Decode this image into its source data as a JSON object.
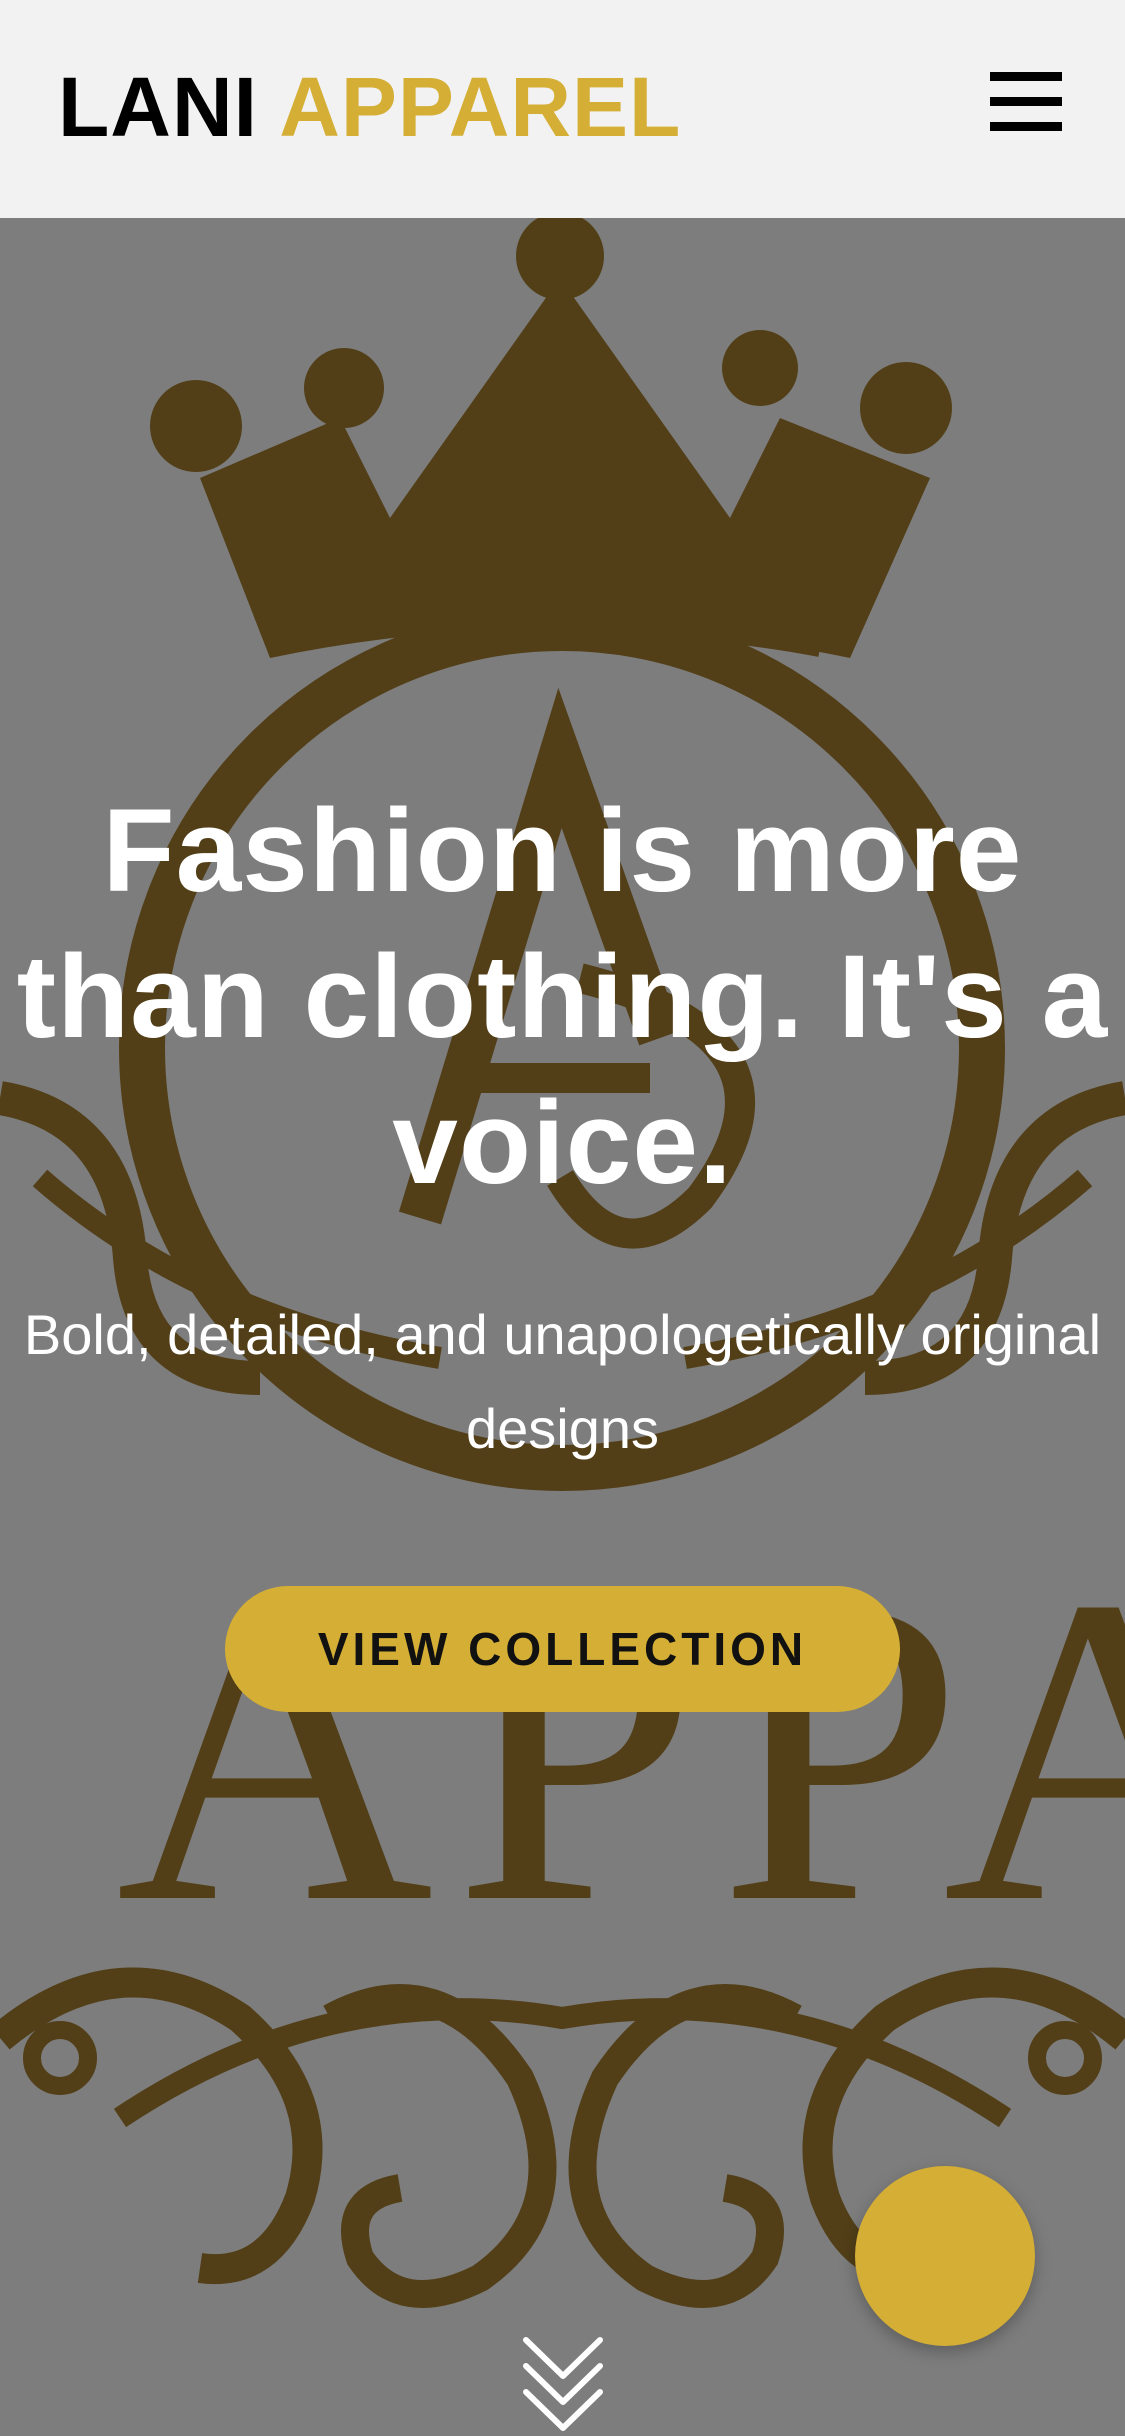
{
  "header": {
    "brand_primary": "LANI",
    "brand_accent": "APPAREL",
    "menu_icon": "hamburger-menu-icon"
  },
  "hero": {
    "background_text": "I APPA",
    "headline": "Fashion is more than clothing. It's a voice.",
    "subtitle": "Bold, detailed, and unapologetically original designs",
    "cta_label": "VIEW COLLECTION",
    "scroll_icon": "chevron-double-down-icon"
  },
  "fab": {
    "icon": "chat-bubble-icon"
  },
  "colors": {
    "accent": "#d4ae35",
    "header_bg": "#f2f2f2",
    "hero_overlay": "#7d7d7d",
    "emblem": "#523f18",
    "text_on_hero": "#ffffff"
  }
}
